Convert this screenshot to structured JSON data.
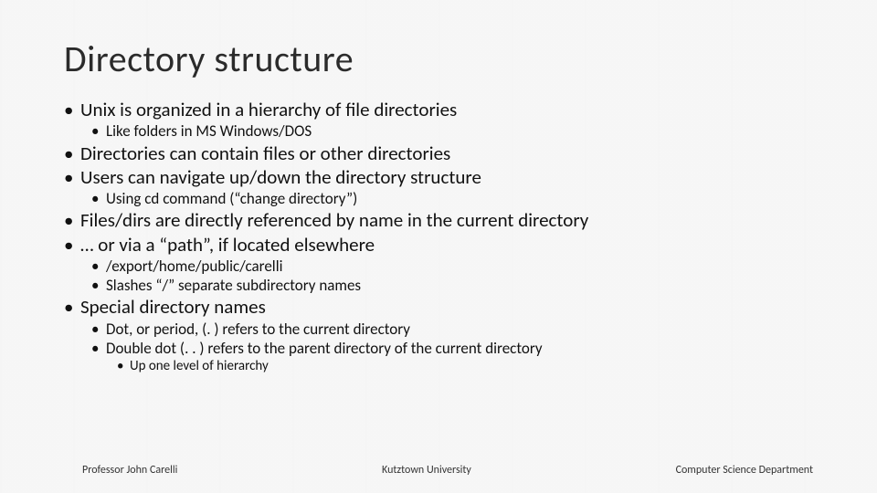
{
  "title": "Directory structure",
  "bullets": {
    "l1_0": "Unix is organized in a hierarchy of file directories",
    "l2_0": "Like folders in MS Windows/DOS",
    "l1_1": "Directories can contain files or other directories",
    "l1_2": "Users can navigate up/down the directory structure",
    "l2_1": "Using cd command (“change directory”)",
    "l1_3": "Files/dirs are directly referenced by name in the current directory",
    "l1_4": "… or via a “path”, if located elsewhere",
    "l2_2": "/export/home/public/carelli",
    "l2_3": "Slashes “/” separate subdirectory names",
    "l1_5": "Special directory names",
    "l2_4": "Dot, or period, (. ) refers to the current directory",
    "l2_5": "Double dot (. . ) refers to the parent directory of the current directory",
    "l3_0": "Up one level of hierarchy"
  },
  "footer": {
    "left": "Professor John Carelli",
    "center": "Kutztown University",
    "right": "Computer Science Department"
  }
}
